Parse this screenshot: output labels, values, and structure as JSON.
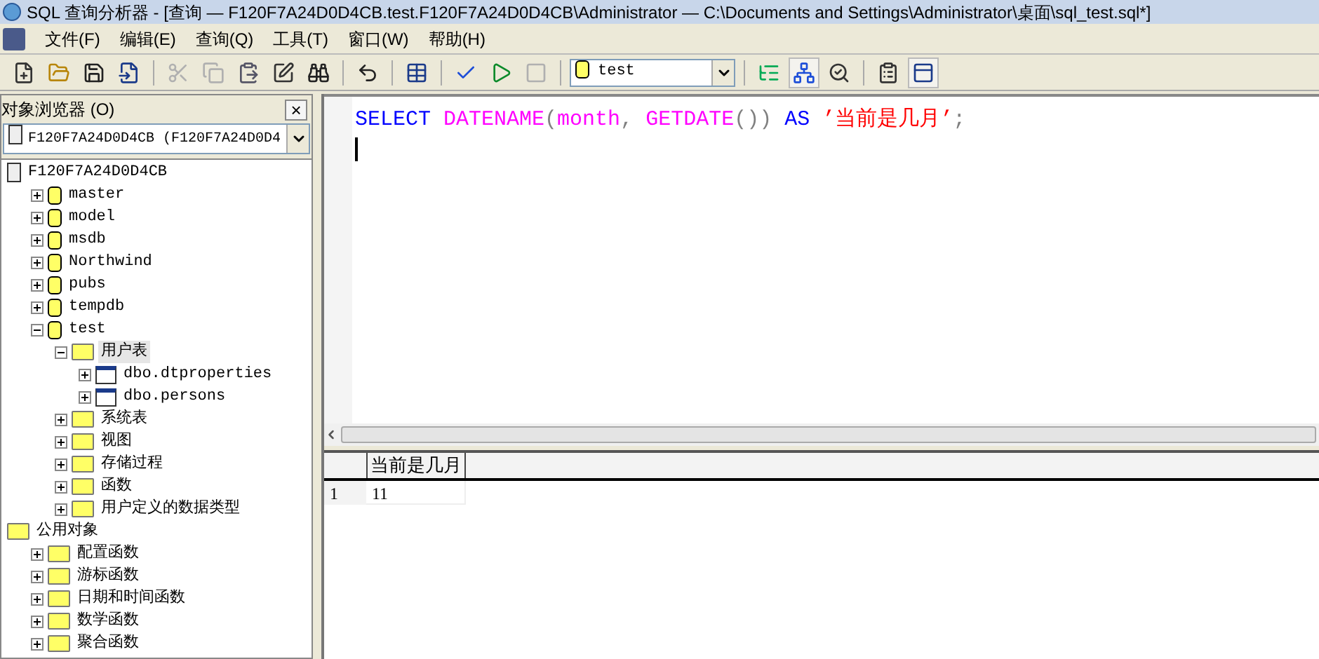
{
  "window": {
    "title": "SQL 查询分析器 - [查询 — F120F7A24D0D4CB.test.F120F7A24D0D4CB\\Administrator — C:\\Documents and Settings\\Administrator\\桌面\\sql_test.sql*]"
  },
  "menu": [
    "文件(F)",
    "编辑(E)",
    "查询(Q)",
    "工具(T)",
    "窗口(W)",
    "帮助(H)"
  ],
  "toolbar": [
    {
      "kind": "new",
      "disabled": false,
      "pressed": false
    },
    {
      "kind": "open",
      "disabled": false,
      "pressed": false
    },
    {
      "kind": "save",
      "disabled": false,
      "pressed": false
    },
    {
      "kind": "insert",
      "disabled": false,
      "pressed": false
    },
    {
      "kind": "sep"
    },
    {
      "kind": "cut",
      "disabled": true,
      "pressed": false
    },
    {
      "kind": "copy",
      "disabled": true,
      "pressed": false
    },
    {
      "kind": "paste",
      "disabled": false,
      "pressed": false
    },
    {
      "kind": "edit",
      "disabled": false,
      "pressed": false
    },
    {
      "kind": "find",
      "disabled": false,
      "pressed": false
    },
    {
      "kind": "sep"
    },
    {
      "kind": "undo",
      "disabled": false,
      "pressed": false
    },
    {
      "kind": "sep"
    },
    {
      "kind": "grid",
      "disabled": false,
      "pressed": false
    },
    {
      "kind": "sep"
    },
    {
      "kind": "check",
      "disabled": false,
      "pressed": false
    },
    {
      "kind": "run",
      "disabled": false,
      "pressed": false
    },
    {
      "kind": "stop",
      "disabled": true,
      "pressed": false
    },
    {
      "kind": "sep"
    },
    {
      "kind": "database"
    },
    {
      "kind": "sep"
    },
    {
      "kind": "plan",
      "disabled": false,
      "pressed": false
    },
    {
      "kind": "browser",
      "disabled": false,
      "pressed": true
    },
    {
      "kind": "search",
      "disabled": false,
      "pressed": false
    },
    {
      "kind": "sep"
    },
    {
      "kind": "properties",
      "disabled": false,
      "pressed": false
    },
    {
      "kind": "results",
      "disabled": false,
      "pressed": true
    }
  ],
  "database_select": {
    "value": "test"
  },
  "object_browser": {
    "title": "对象浏览器 (O)",
    "close": "×",
    "server_select": {
      "value": "F120F7A24D0D4CB (F120F7A24D0D4"
    },
    "tree": [
      {
        "label": "F120F7A24D0D4CB",
        "kind": "server",
        "selected": false,
        "children": [
          {
            "label": "master",
            "kind": "database",
            "expanded": false,
            "selected": false
          },
          {
            "label": "model",
            "kind": "database",
            "expanded": false,
            "selected": false
          },
          {
            "label": "msdb",
            "kind": "database",
            "expanded": false,
            "selected": false
          },
          {
            "label": "Northwind",
            "kind": "database",
            "expanded": false,
            "selected": false
          },
          {
            "label": "pubs",
            "kind": "database",
            "expanded": false,
            "selected": false
          },
          {
            "label": "tempdb",
            "kind": "database",
            "expanded": false,
            "selected": false
          },
          {
            "label": "test",
            "kind": "database",
            "expanded": true,
            "selected": false,
            "children": [
              {
                "label": "用户表",
                "kind": "folder",
                "expanded": true,
                "selected": true,
                "children": [
                  {
                    "label": "dbo.dtproperties",
                    "kind": "table",
                    "expanded": false,
                    "selected": false
                  },
                  {
                    "label": "dbo.persons",
                    "kind": "table",
                    "expanded": false,
                    "selected": false
                  }
                ]
              },
              {
                "label": "系统表",
                "kind": "folder",
                "expanded": false,
                "selected": false
              },
              {
                "label": "视图",
                "kind": "folder",
                "expanded": false,
                "selected": false
              },
              {
                "label": "存储过程",
                "kind": "folder",
                "expanded": false,
                "selected": false
              },
              {
                "label": "函数",
                "kind": "folder",
                "expanded": false,
                "selected": false
              },
              {
                "label": "用户定义的数据类型",
                "kind": "folder",
                "expanded": false,
                "selected": false
              }
            ]
          }
        ]
      },
      {
        "label": "公用对象",
        "kind": "folder",
        "selected": false,
        "children": [
          {
            "label": "配置函数",
            "kind": "folder",
            "expanded": false,
            "selected": false
          },
          {
            "label": "游标函数",
            "kind": "folder",
            "expanded": false,
            "selected": false
          },
          {
            "label": "日期和时间函数",
            "kind": "folder",
            "expanded": false,
            "selected": false
          },
          {
            "label": "数学函数",
            "kind": "folder",
            "expanded": false,
            "selected": false
          },
          {
            "label": "聚合函数",
            "kind": "folder",
            "expanded": false,
            "selected": false
          }
        ]
      }
    ]
  },
  "editor": {
    "words": [
      [
        {
          "text": "SELECT",
          "kind": "keyword"
        }
      ],
      [
        {
          "text": "DATENAME",
          "kind": "function"
        },
        {
          "text": "(",
          "kind": "punct"
        },
        {
          "text": "month",
          "kind": "function"
        },
        {
          "text": ",",
          "kind": "punct"
        }
      ],
      [
        {
          "text": "GETDATE",
          "kind": "function"
        },
        {
          "text": "())",
          "kind": "punct"
        }
      ],
      [
        {
          "text": "AS",
          "kind": "keyword"
        }
      ],
      [
        {
          "text": "’当前是几月’",
          "kind": "string"
        },
        {
          "text": ";",
          "kind": "punct"
        }
      ]
    ]
  },
  "results": {
    "columns": [
      "当前是几月"
    ],
    "rows": [
      {
        "number": "1",
        "cells": [
          "11"
        ]
      }
    ]
  }
}
